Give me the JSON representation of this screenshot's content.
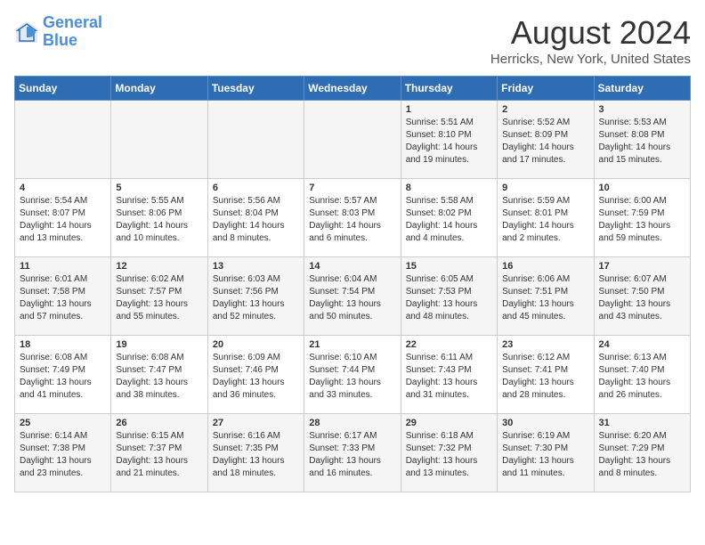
{
  "header": {
    "logo_line1": "General",
    "logo_line2": "Blue",
    "title": "August 2024",
    "subtitle": "Herricks, New York, United States"
  },
  "weekdays": [
    "Sunday",
    "Monday",
    "Tuesday",
    "Wednesday",
    "Thursday",
    "Friday",
    "Saturday"
  ],
  "weeks": [
    [
      {
        "day": "",
        "info": ""
      },
      {
        "day": "",
        "info": ""
      },
      {
        "day": "",
        "info": ""
      },
      {
        "day": "",
        "info": ""
      },
      {
        "day": "1",
        "info": "Sunrise: 5:51 AM\nSunset: 8:10 PM\nDaylight: 14 hours\nand 19 minutes."
      },
      {
        "day": "2",
        "info": "Sunrise: 5:52 AM\nSunset: 8:09 PM\nDaylight: 14 hours\nand 17 minutes."
      },
      {
        "day": "3",
        "info": "Sunrise: 5:53 AM\nSunset: 8:08 PM\nDaylight: 14 hours\nand 15 minutes."
      }
    ],
    [
      {
        "day": "4",
        "info": "Sunrise: 5:54 AM\nSunset: 8:07 PM\nDaylight: 14 hours\nand 13 minutes."
      },
      {
        "day": "5",
        "info": "Sunrise: 5:55 AM\nSunset: 8:06 PM\nDaylight: 14 hours\nand 10 minutes."
      },
      {
        "day": "6",
        "info": "Sunrise: 5:56 AM\nSunset: 8:04 PM\nDaylight: 14 hours\nand 8 minutes."
      },
      {
        "day": "7",
        "info": "Sunrise: 5:57 AM\nSunset: 8:03 PM\nDaylight: 14 hours\nand 6 minutes."
      },
      {
        "day": "8",
        "info": "Sunrise: 5:58 AM\nSunset: 8:02 PM\nDaylight: 14 hours\nand 4 minutes."
      },
      {
        "day": "9",
        "info": "Sunrise: 5:59 AM\nSunset: 8:01 PM\nDaylight: 14 hours\nand 2 minutes."
      },
      {
        "day": "10",
        "info": "Sunrise: 6:00 AM\nSunset: 7:59 PM\nDaylight: 13 hours\nand 59 minutes."
      }
    ],
    [
      {
        "day": "11",
        "info": "Sunrise: 6:01 AM\nSunset: 7:58 PM\nDaylight: 13 hours\nand 57 minutes."
      },
      {
        "day": "12",
        "info": "Sunrise: 6:02 AM\nSunset: 7:57 PM\nDaylight: 13 hours\nand 55 minutes."
      },
      {
        "day": "13",
        "info": "Sunrise: 6:03 AM\nSunset: 7:56 PM\nDaylight: 13 hours\nand 52 minutes."
      },
      {
        "day": "14",
        "info": "Sunrise: 6:04 AM\nSunset: 7:54 PM\nDaylight: 13 hours\nand 50 minutes."
      },
      {
        "day": "15",
        "info": "Sunrise: 6:05 AM\nSunset: 7:53 PM\nDaylight: 13 hours\nand 48 minutes."
      },
      {
        "day": "16",
        "info": "Sunrise: 6:06 AM\nSunset: 7:51 PM\nDaylight: 13 hours\nand 45 minutes."
      },
      {
        "day": "17",
        "info": "Sunrise: 6:07 AM\nSunset: 7:50 PM\nDaylight: 13 hours\nand 43 minutes."
      }
    ],
    [
      {
        "day": "18",
        "info": "Sunrise: 6:08 AM\nSunset: 7:49 PM\nDaylight: 13 hours\nand 41 minutes."
      },
      {
        "day": "19",
        "info": "Sunrise: 6:08 AM\nSunset: 7:47 PM\nDaylight: 13 hours\nand 38 minutes."
      },
      {
        "day": "20",
        "info": "Sunrise: 6:09 AM\nSunset: 7:46 PM\nDaylight: 13 hours\nand 36 minutes."
      },
      {
        "day": "21",
        "info": "Sunrise: 6:10 AM\nSunset: 7:44 PM\nDaylight: 13 hours\nand 33 minutes."
      },
      {
        "day": "22",
        "info": "Sunrise: 6:11 AM\nSunset: 7:43 PM\nDaylight: 13 hours\nand 31 minutes."
      },
      {
        "day": "23",
        "info": "Sunrise: 6:12 AM\nSunset: 7:41 PM\nDaylight: 13 hours\nand 28 minutes."
      },
      {
        "day": "24",
        "info": "Sunrise: 6:13 AM\nSunset: 7:40 PM\nDaylight: 13 hours\nand 26 minutes."
      }
    ],
    [
      {
        "day": "25",
        "info": "Sunrise: 6:14 AM\nSunset: 7:38 PM\nDaylight: 13 hours\nand 23 minutes."
      },
      {
        "day": "26",
        "info": "Sunrise: 6:15 AM\nSunset: 7:37 PM\nDaylight: 13 hours\nand 21 minutes."
      },
      {
        "day": "27",
        "info": "Sunrise: 6:16 AM\nSunset: 7:35 PM\nDaylight: 13 hours\nand 18 minutes."
      },
      {
        "day": "28",
        "info": "Sunrise: 6:17 AM\nSunset: 7:33 PM\nDaylight: 13 hours\nand 16 minutes."
      },
      {
        "day": "29",
        "info": "Sunrise: 6:18 AM\nSunset: 7:32 PM\nDaylight: 13 hours\nand 13 minutes."
      },
      {
        "day": "30",
        "info": "Sunrise: 6:19 AM\nSunset: 7:30 PM\nDaylight: 13 hours\nand 11 minutes."
      },
      {
        "day": "31",
        "info": "Sunrise: 6:20 AM\nSunset: 7:29 PM\nDaylight: 13 hours\nand 8 minutes."
      }
    ]
  ]
}
